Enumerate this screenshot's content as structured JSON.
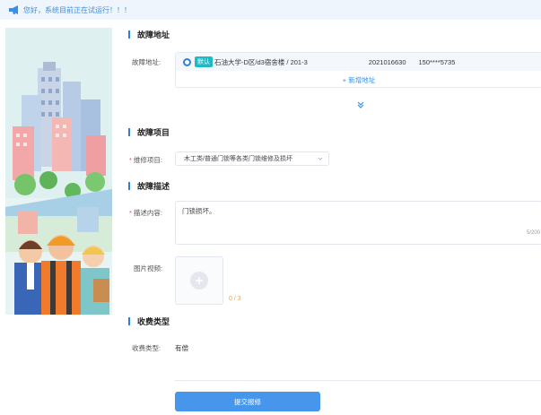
{
  "notice": {
    "text": "您好，系统目前正在试运行！！！"
  },
  "sections": {
    "address": "故障地址",
    "item": "故障项目",
    "description": "故障描述",
    "charge": "收费类型"
  },
  "address": {
    "label": "故障地址:",
    "tag": "默认",
    "location": "石油大学-D区/d3宿舍楼 / 201-3",
    "student_id": "2021016630",
    "phone": "150****5735",
    "add_label": "+  新增地址"
  },
  "item": {
    "label": "维修项目:",
    "selected": "木工类/普通门锁等各类门锁维修及损坏"
  },
  "description": {
    "label": "描述内容:",
    "value": "门锁损坏。",
    "counter": "5/200"
  },
  "media": {
    "label": "图片视频:",
    "count": "0 / 3"
  },
  "charge": {
    "label": "收费类型:",
    "value": "有偿"
  },
  "submit_label": "提交报修",
  "colors": {
    "accent": "#2f7fd8",
    "button": "#4696ec",
    "required": "#e64a4a",
    "tag": "#1fb9c6"
  },
  "icons": [
    "megaphone-icon",
    "radio-selected-icon",
    "double-chevron-down-icon",
    "chevron-down-icon",
    "plus-icon"
  ]
}
